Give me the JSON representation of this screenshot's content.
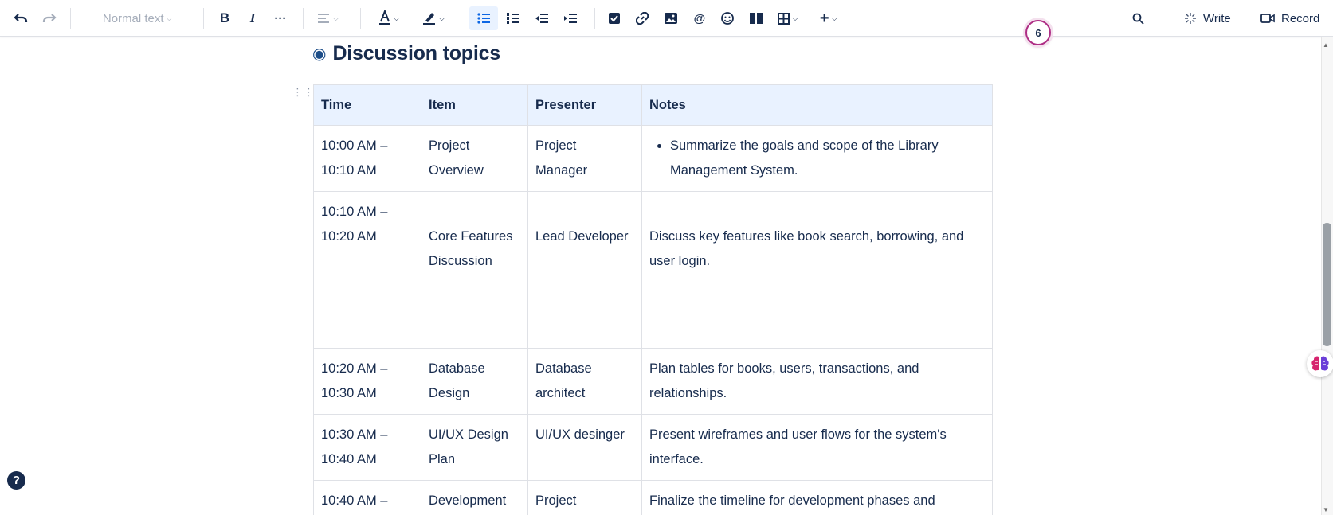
{
  "toolbar": {
    "text_style": "Normal text",
    "write_label": "Write",
    "record_label": "Record"
  },
  "badge_count": "6",
  "page": {
    "heading": "Discussion topics"
  },
  "table": {
    "headers": [
      "Time",
      "Item",
      "Presenter",
      "Notes"
    ],
    "rows": [
      {
        "time": [
          "10:00 AM –",
          "10:10 AM"
        ],
        "item": [
          "Project",
          "Overview"
        ],
        "presenter": [
          "Project",
          "Manager"
        ],
        "notes": "Summarize the goals and scope of the Library Management System."
      },
      {
        "time": [
          "10:10 AM –",
          "10:20 AM"
        ],
        "item": [
          "Core Features",
          "Discussion"
        ],
        "presenter": [
          "Lead Developer",
          ""
        ],
        "notes": "Discuss key features like book search, borrowing, and user login."
      },
      {
        "time": [
          "10:20 AM –",
          "10:30 AM"
        ],
        "item": [
          "Database",
          "Design"
        ],
        "presenter": [
          "Database",
          "architect"
        ],
        "notes": "Plan tables for books, users, transactions, and relationships."
      },
      {
        "time": [
          "10:30 AM –",
          "10:40 AM"
        ],
        "item": [
          "UI/UX Design",
          "Plan"
        ],
        "presenter": [
          "UI/UX desinger",
          ""
        ],
        "notes": "Present wireframes and user flows for the system's interface."
      },
      {
        "time": [
          "10:40 AM –",
          ""
        ],
        "item": [
          "Development",
          ""
        ],
        "presenter": [
          "Project",
          ""
        ],
        "notes": "Finalize the timeline for development phases and"
      }
    ]
  },
  "colors": {
    "header_bg": "#e9f2ff",
    "active_tool": "#0c66e4",
    "badge_ring": "#ae2e85"
  }
}
